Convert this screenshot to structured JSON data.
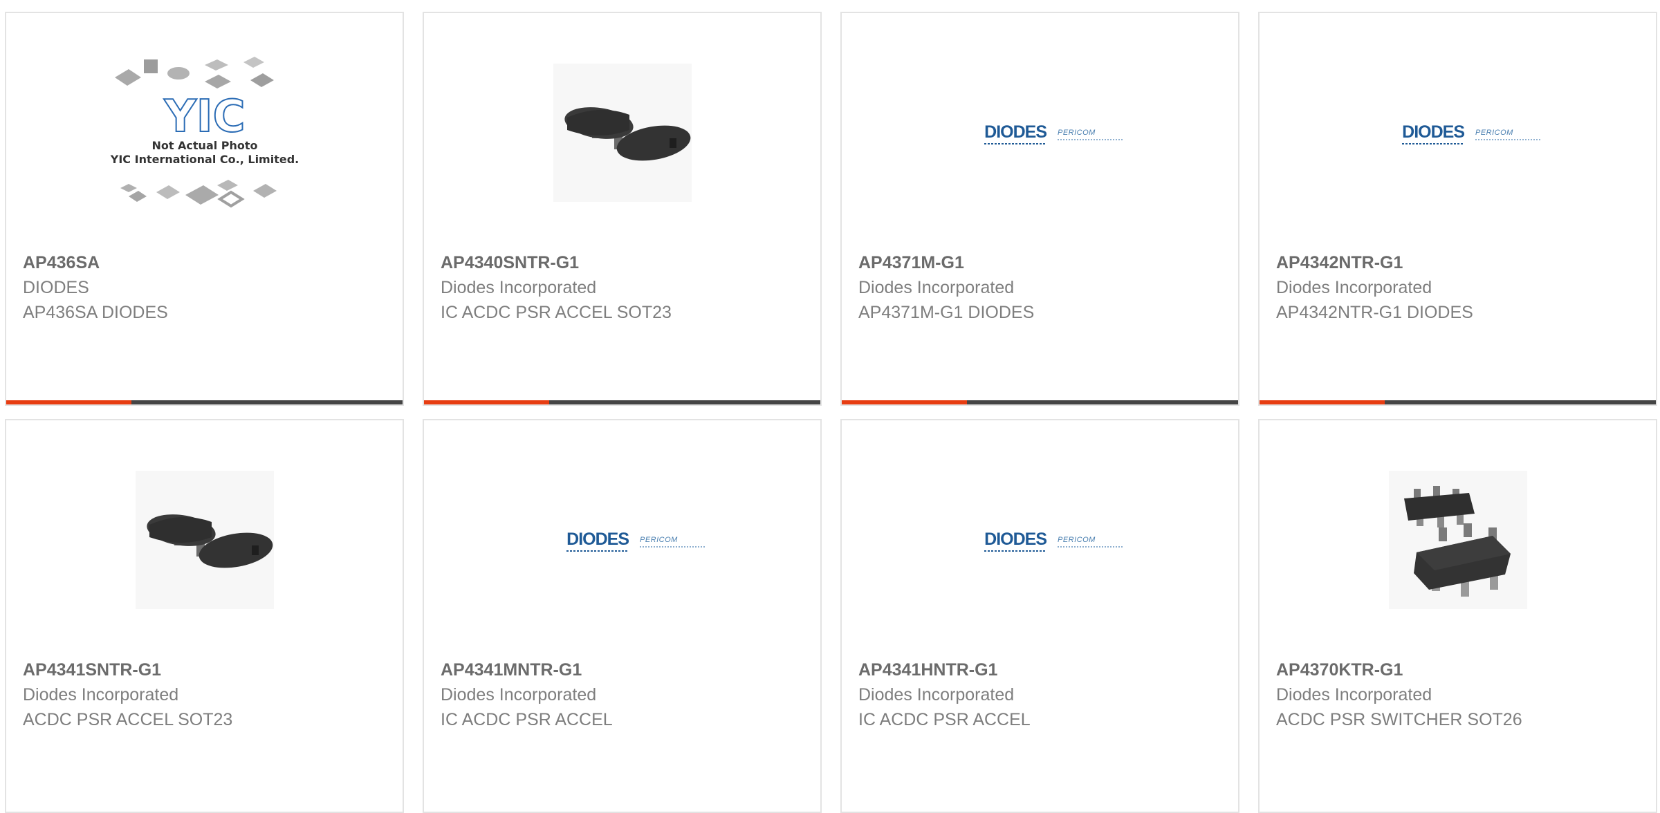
{
  "accent_color": "#e73d12",
  "bar_color": "#454545",
  "products": [
    {
      "part": "AP436SA",
      "manufacturer": "DIODES",
      "description": "AP436SA DIODES",
      "image": "placeholder-yic"
    },
    {
      "part": "AP4340SNTR-G1",
      "manufacturer": "Diodes Incorporated",
      "description": "IC ACDC PSR ACCEL SOT23",
      "image": "sot23-chip"
    },
    {
      "part": "AP4371M-G1",
      "manufacturer": "Diodes Incorporated",
      "description": "AP4371M-G1 DIODES",
      "image": "diodes-logo"
    },
    {
      "part": "AP4342NTR-G1",
      "manufacturer": "Diodes Incorporated",
      "description": "AP4342NTR-G1 DIODES",
      "image": "diodes-logo"
    },
    {
      "part": "AP4341SNTR-G1",
      "manufacturer": "Diodes Incorporated",
      "description": "ACDC PSR ACCEL SOT23",
      "image": "sot23-chip"
    },
    {
      "part": "AP4341MNTR-G1",
      "manufacturer": "Diodes Incorporated",
      "description": "IC ACDC PSR ACCEL",
      "image": "diodes-logo"
    },
    {
      "part": "AP4341HNTR-G1",
      "manufacturer": "Diodes Incorporated",
      "description": "IC ACDC PSR ACCEL",
      "image": "diodes-logo"
    },
    {
      "part": "AP4370KTR-G1",
      "manufacturer": "Diodes Incorporated",
      "description": "ACDC PSR SWITCHER SOT26",
      "image": "sot26-chip"
    }
  ],
  "logo": {
    "brand": "DIODES",
    "sub_brand": "PERICOM"
  },
  "placeholder": {
    "logo_text": "YIC",
    "line1": "Not Actual Photo",
    "line2": "YIC International Co., Limited."
  }
}
